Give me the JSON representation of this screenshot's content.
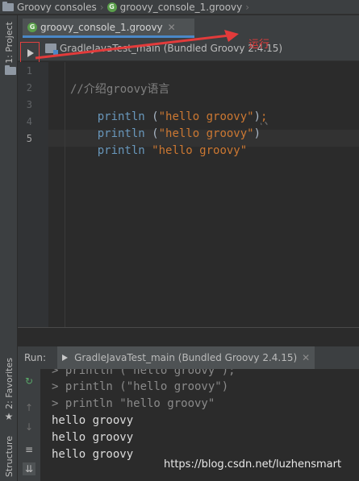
{
  "breadcrumb": {
    "root": "Groovy consoles",
    "file": "groovy_console_1.groovy"
  },
  "left_strip": {
    "project_tab": "1: Project",
    "favorites_tab": "2: Favorites",
    "structure_tab": "Structure"
  },
  "editor_tab": {
    "label": "groovy_console_1.groovy",
    "close": "✕"
  },
  "console_toolbar": {
    "module": "GradleJavaTest_main (Bundled Groovy 2.4.15)"
  },
  "annotation": {
    "label": "运行"
  },
  "editor": {
    "line_numbers": [
      "1",
      "2",
      "3",
      "4",
      "5"
    ],
    "lines": {
      "comment": "//介绍groovy语言",
      "l3_fn": "println",
      "l3_open": " (",
      "l3_str": "\"hello groovy\"",
      "l3_close": ")",
      "l3_semi": ";",
      "l4_fn": "println",
      "l4_open": " (",
      "l4_str": "\"hello groovy\"",
      "l4_close": ")",
      "l5_fn": "println",
      "l5_str": " \"hello groovy\""
    }
  },
  "run_panel": {
    "label": "Run:",
    "tab": "GradleJavaTest_main (Bundled Groovy 2.4.15)",
    "close": "✕",
    "output": [
      "> println (\"hello groovy\");",
      "> println (\"hello groovy\")",
      "> println \"hello groovy\"",
      "hello groovy",
      "hello groovy",
      "hello groovy"
    ]
  },
  "watermark": "https://blog.csdn.net/luzhensmart",
  "colors": {
    "accent": "#4a88c7",
    "annotation": "#e23b3b",
    "string": "#cc7832",
    "function": "#6897bb",
    "comment": "#808080"
  }
}
